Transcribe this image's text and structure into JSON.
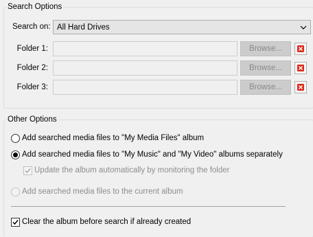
{
  "search_options": {
    "title": "Search Options",
    "search_on_label": "Search on:",
    "search_on_value": "All Hard Drives",
    "folders": [
      {
        "label": "Folder 1:",
        "value": "",
        "browse_label": "Browse..."
      },
      {
        "label": "Folder 2:",
        "value": "",
        "browse_label": "Browse..."
      },
      {
        "label": "Folder 3:",
        "value": "",
        "browse_label": "Browse..."
      }
    ]
  },
  "other_options": {
    "title": "Other Options",
    "radio_my_media_files": "Add searched media files to \"My Media Files\" album",
    "radio_my_music_video": "Add searched media files to \"My Music\" and \"My Video\" albums separately",
    "check_update_album": "Update the album automatically by monitoring the folder",
    "radio_current_album": "Add searched media files to the current album",
    "check_clear_album": "Clear the album before search if already created",
    "selected_radio": "my_music_video",
    "update_album_checked": true,
    "clear_album_checked": true
  },
  "colors": {
    "delete_icon": "#d92d1f",
    "background": "#f0f0f0"
  }
}
